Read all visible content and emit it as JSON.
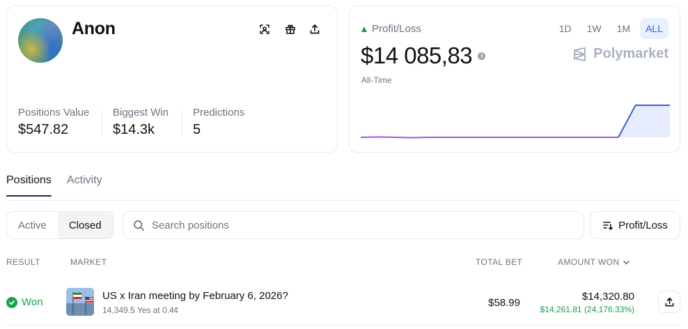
{
  "profile": {
    "username": "Anon",
    "icons": [
      "scan-icon",
      "gift-icon",
      "share-icon"
    ],
    "stats": [
      {
        "label": "Positions Value",
        "value": "$547.82"
      },
      {
        "label": "Biggest Win",
        "value": "$14.3k"
      },
      {
        "label": "Predictions",
        "value": "5"
      }
    ]
  },
  "pnl": {
    "label": "Profit/Loss",
    "value": "$14 085,83",
    "info_glyph": "i",
    "period": "All-Time",
    "ranges": [
      "1D",
      "1W",
      "1M",
      "ALL"
    ],
    "active_range": "ALL",
    "brand": "Polymarket",
    "colors": {
      "up": "#16a34a",
      "line_before": "#9b59d6",
      "line_after": "#3b5bdb",
      "fill": "#e8ecff"
    },
    "series": [
      0,
      0.01,
      0,
      -0.01,
      0,
      0,
      0,
      0,
      0,
      0,
      0,
      0,
      0,
      0,
      0,
      0,
      1,
      1,
      1
    ]
  },
  "tabs": {
    "positions": "Positions",
    "activity": "Activity"
  },
  "filter": {
    "active": "Active",
    "closed": "Closed",
    "selected": "Closed"
  },
  "search": {
    "placeholder": "Search positions",
    "value": ""
  },
  "sort": {
    "label": "Profit/Loss"
  },
  "table": {
    "headers": {
      "result": "RESULT",
      "market": "MARKET",
      "total_bet": "TOTAL BET",
      "amount_won": "AMOUNT WON"
    },
    "rows": [
      {
        "result": "Won",
        "market": "US x Iran meeting by February 6, 2026?",
        "detail": "14,349.5 Yes at 0.4¢",
        "total_bet": "$58.99",
        "amount_won": "$14,320.80",
        "profit": "$14,261.81 (24,176.33%)"
      }
    ]
  }
}
